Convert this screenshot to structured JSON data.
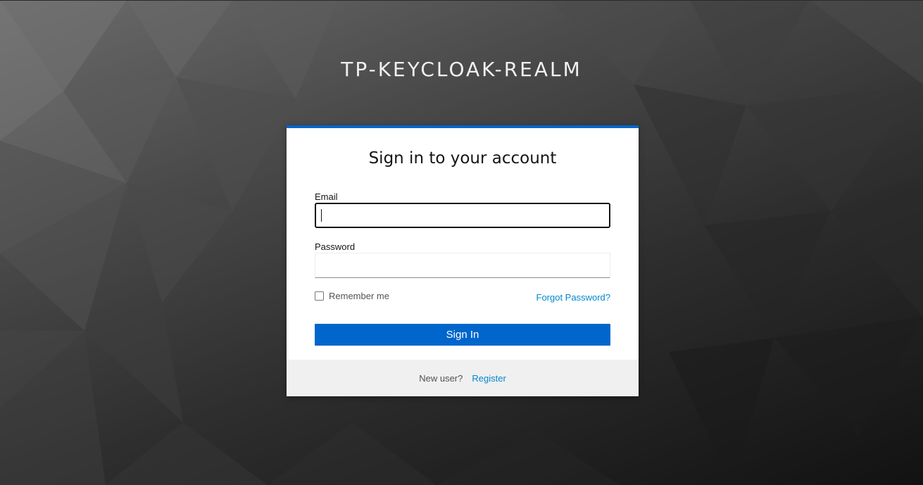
{
  "realm": {
    "title": "TP-KEYCLOAK-REALM"
  },
  "login_form": {
    "heading": "Sign in to your account",
    "email_label": "Email",
    "email_value": "",
    "password_label": "Password",
    "password_value": "",
    "remember_me_label": "Remember me",
    "remember_me_checked": false,
    "forgot_password_label": "Forgot Password?",
    "submit_label": "Sign In"
  },
  "footer": {
    "new_user_text": "New user?",
    "register_label": "Register"
  },
  "colors": {
    "accent": "#0066cc",
    "link": "#0088ce",
    "footer_bg": "#f0f0f0"
  }
}
